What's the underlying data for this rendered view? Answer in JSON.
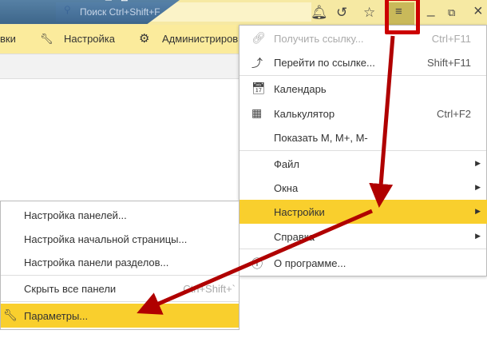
{
  "top": {
    "search_placeholder": "Поиск Ctrl+Shift+F",
    "window_min": "_",
    "window_restore": "⧉",
    "window_close": "×"
  },
  "toolbar": {
    "items": [
      {
        "label": "вки"
      },
      {
        "label": "Настройка",
        "icon": "wrench-icon"
      },
      {
        "label": "Администриров",
        "icon": "gear-icon"
      }
    ]
  },
  "main_menu": {
    "items": [
      {
        "label": "Получить ссылку...",
        "shortcut": "Ctrl+F11",
        "icon": "link-icon",
        "disabled": true
      },
      {
        "label": "Перейти по ссылке...",
        "shortcut": "Shift+F11",
        "icon": "follow-link-icon"
      },
      {
        "label": "Календарь",
        "icon": "calendar-icon"
      },
      {
        "label": "Калькулятор",
        "shortcut": "Ctrl+F2",
        "icon": "calculator-icon"
      },
      {
        "label": "Показать М, М+, М-"
      },
      {
        "label": "Файл",
        "submenu": true
      },
      {
        "label": "Окна",
        "submenu": true
      },
      {
        "label": "Настройки",
        "submenu": true,
        "highlighted": true
      },
      {
        "label": "Справка",
        "submenu": true
      },
      {
        "label": "О программе...",
        "icon": "info-icon"
      }
    ]
  },
  "sub_menu": {
    "items": [
      {
        "label": "Настройка панелей..."
      },
      {
        "label": "Настройка начальной страницы..."
      },
      {
        "label": "Настройка панели разделов..."
      },
      {
        "label": "Скрыть все панели",
        "shortcut": "Ctrl+Shift+`"
      },
      {
        "label": "Параметры...",
        "icon": "wrench-icon",
        "highlighted": true
      }
    ]
  },
  "colors": {
    "highlight": "#f9cf2d",
    "annotation": "#c00000",
    "toolbar": "#fbeb9c"
  }
}
